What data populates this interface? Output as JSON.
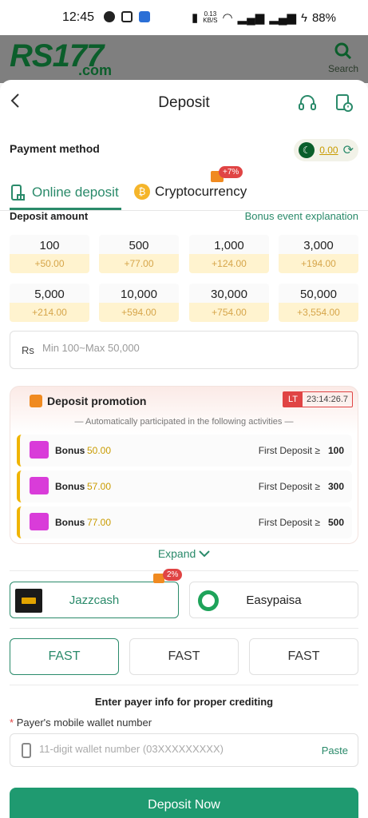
{
  "status_bar": {
    "time": "12:45",
    "network_speed": "0.13",
    "network_unit": "KB/S",
    "battery": "88%"
  },
  "header": {
    "logo_text": "RS177",
    "logo_sub": ".com",
    "search_label": "Search"
  },
  "page": {
    "title": "Deposit"
  },
  "payment_method": {
    "label": "Payment method",
    "balance": "0.00"
  },
  "tabs": [
    {
      "label": "Online deposit",
      "active": true
    },
    {
      "label": "Cryptocurrency",
      "active": false,
      "badge": "+7%"
    }
  ],
  "deposit_amount": {
    "label": "Deposit amount",
    "bonus_link": "Bonus event explanation",
    "options": [
      {
        "amount": "100",
        "bonus": "+50.00"
      },
      {
        "amount": "500",
        "bonus": "+77.00"
      },
      {
        "amount": "1,000",
        "bonus": "+124.00"
      },
      {
        "amount": "3,000",
        "bonus": "+194.00"
      },
      {
        "amount": "5,000",
        "bonus": "+214.00"
      },
      {
        "amount": "10,000",
        "bonus": "+594.00"
      },
      {
        "amount": "30,000",
        "bonus": "+754.00"
      },
      {
        "amount": "50,000",
        "bonus": "+3,554.00"
      }
    ],
    "currency": "Rs",
    "placeholder": "Min 100~Max 50,000"
  },
  "promotion": {
    "title": "Deposit promotion",
    "tag": "LT",
    "countdown": "23:14:26.7",
    "subtitle": "Automatically participated in the following activities",
    "rows": [
      {
        "label": "Bonus",
        "value": "50.00",
        "condition": "First Deposit ≥",
        "threshold": "100"
      },
      {
        "label": "Bonus",
        "value": "57.00",
        "condition": "First Deposit ≥",
        "threshold": "300"
      },
      {
        "label": "Bonus",
        "value": "77.00",
        "condition": "First Deposit ≥",
        "threshold": "500"
      }
    ],
    "expand_label": "Expand"
  },
  "channels": [
    {
      "name": "Jazzcash",
      "active": true,
      "badge": "2%"
    },
    {
      "name": "Easypaisa",
      "active": false
    }
  ],
  "speeds": [
    {
      "label": "FAST",
      "active": true
    },
    {
      "label": "FAST",
      "active": false
    },
    {
      "label": "FAST",
      "active": false
    }
  ],
  "payer": {
    "heading": "Enter payer info for proper crediting",
    "wallet_label": "Payer's mobile wallet number",
    "wallet_placeholder": "11-digit wallet number (03XXXXXXXXX)",
    "paste_label": "Paste"
  },
  "submit_label": "Deposit Now",
  "colors": {
    "accent": "#2a8a6a",
    "button": "#1f9a70",
    "bonus": "#d6a54a",
    "badge": "#e04444"
  }
}
